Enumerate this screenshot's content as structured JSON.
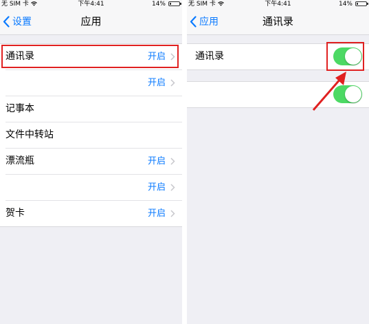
{
  "status_bar": {
    "carrier": "无 SIM 卡",
    "time": "下午4:41",
    "battery": "14%"
  },
  "left_screen": {
    "back_label": "设置",
    "title": "应用",
    "rows": [
      {
        "label": "通讯录",
        "value": "开启"
      },
      {
        "label": "",
        "value": "开启"
      },
      {
        "label": "记事本",
        "value": ""
      },
      {
        "label": "文件中转站",
        "value": ""
      },
      {
        "label": "漂流瓶",
        "value": "开启"
      },
      {
        "label": "",
        "value": "开启"
      },
      {
        "label": "贺卡",
        "value": "开启"
      }
    ]
  },
  "right_screen": {
    "back_label": "应用",
    "title": "通讯录",
    "rows": [
      {
        "label": "通讯录",
        "toggle_on": true
      },
      {
        "label": "",
        "toggle_on": true
      }
    ]
  },
  "colors": {
    "accent_blue": "#0a7aff",
    "toggle_green": "#4cd964",
    "annotation_red": "#e02020"
  }
}
